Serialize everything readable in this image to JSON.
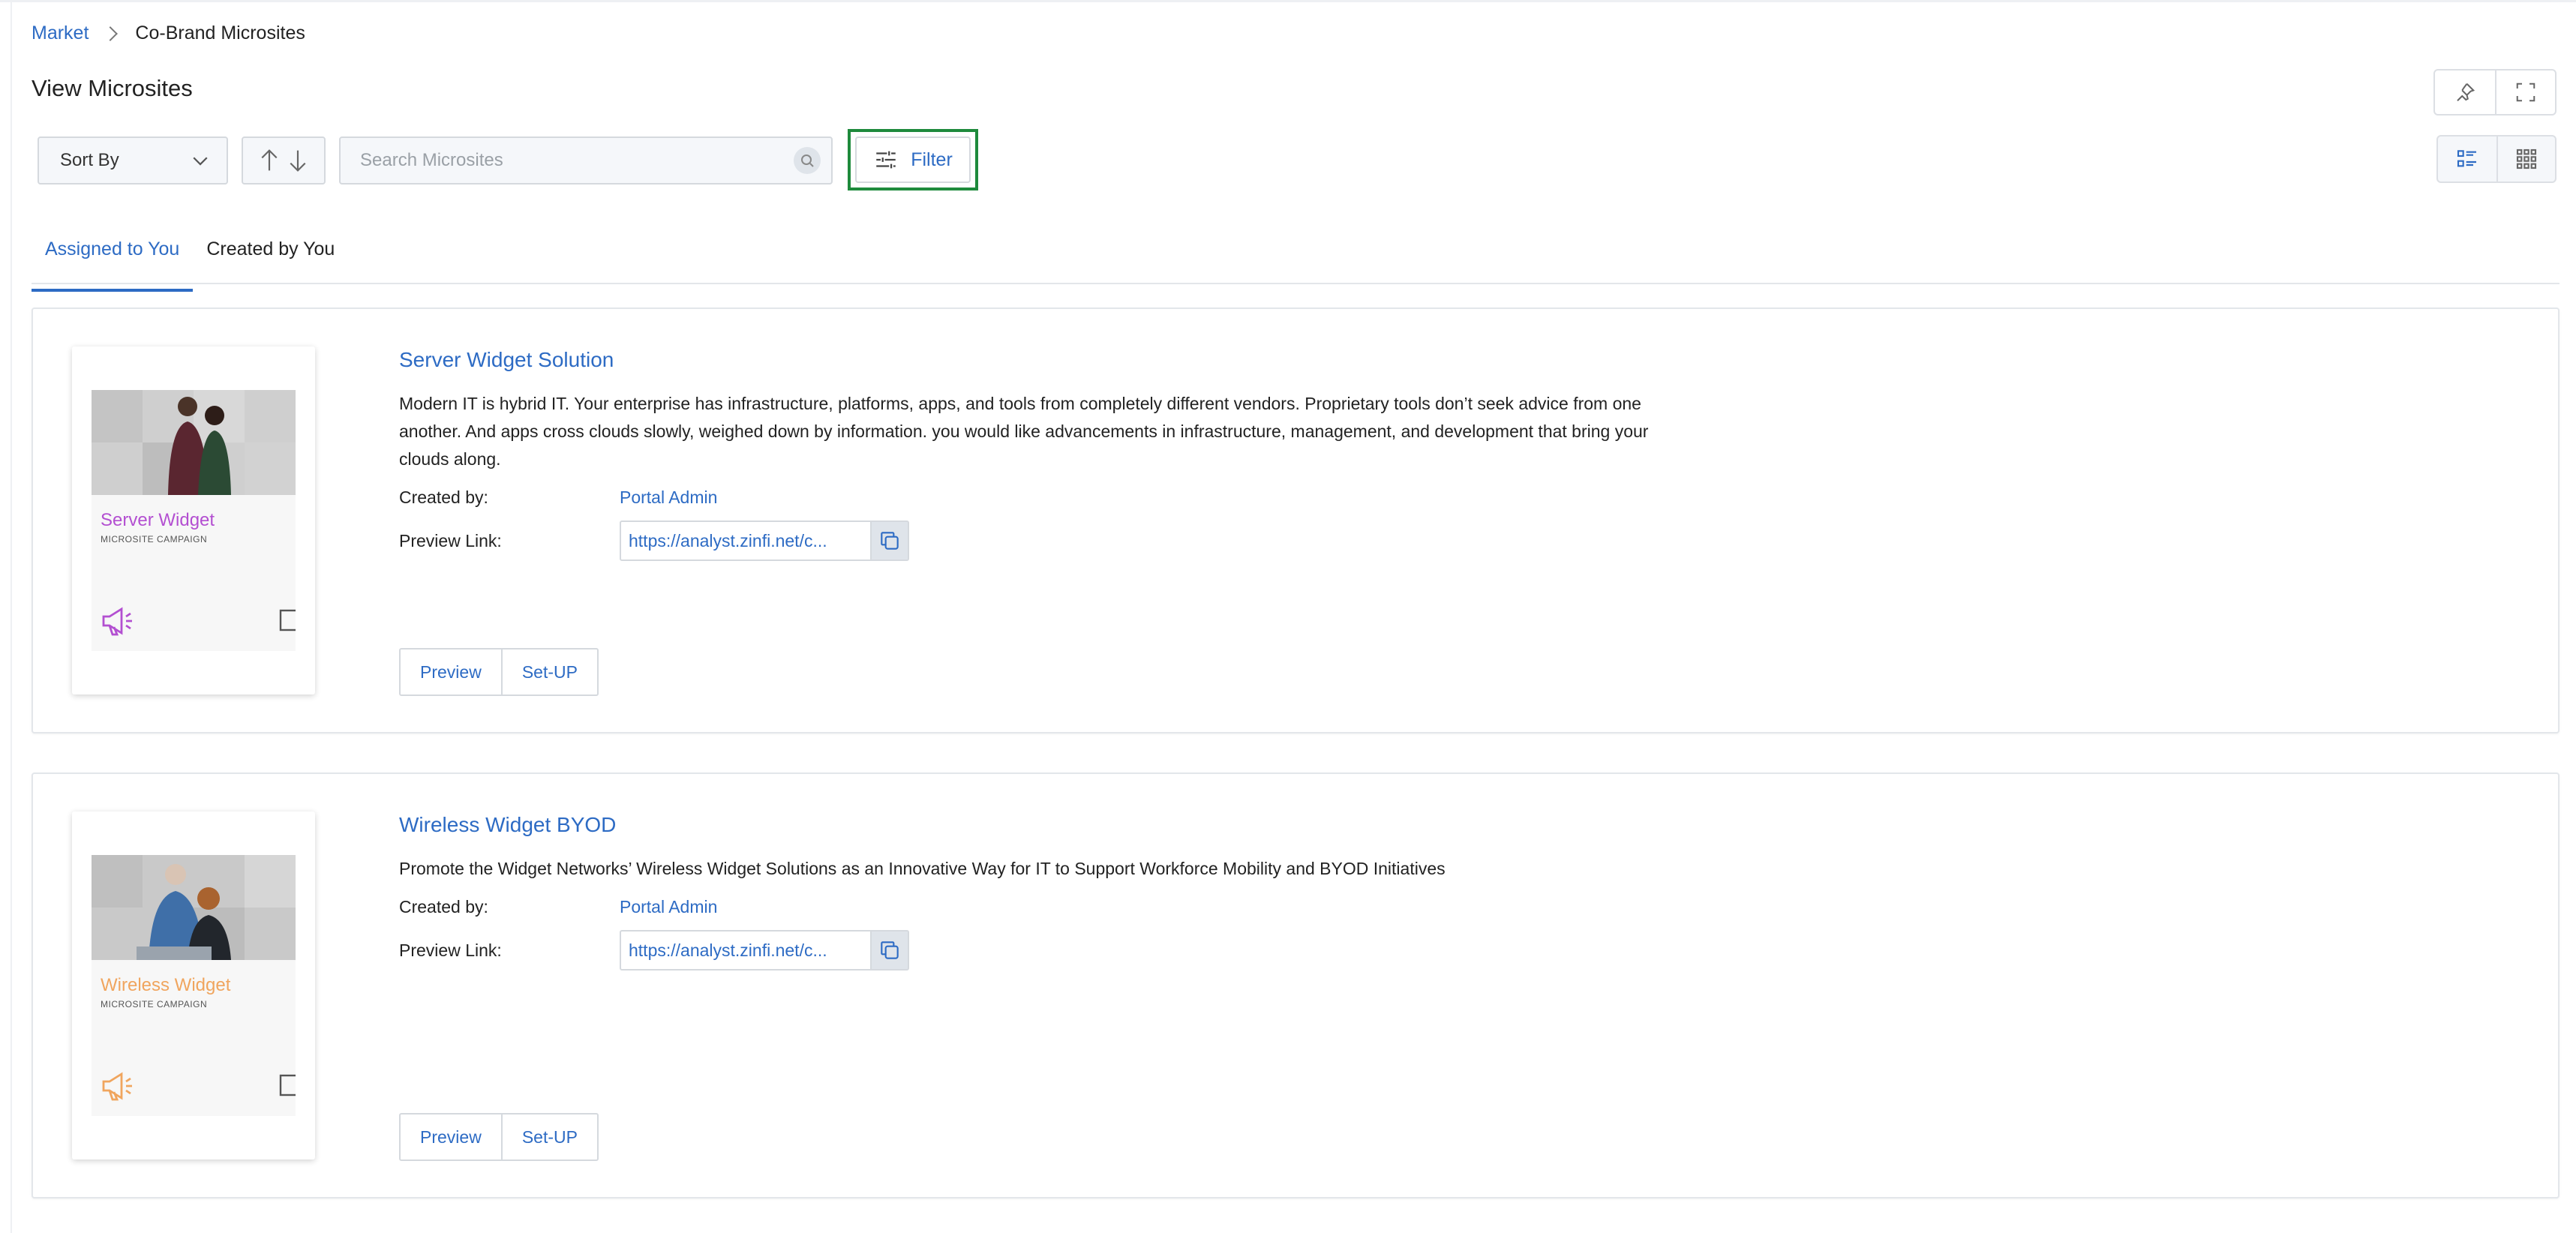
{
  "breadcrumb": {
    "items": [
      "Market",
      "Co-Brand Microsites"
    ]
  },
  "page": {
    "title": "View Microsites"
  },
  "toolbar": {
    "sort_label": "Sort By",
    "search_placeholder": "Search Microsites",
    "filter_label": "Filter"
  },
  "tabs": [
    {
      "label": "Assigned to You",
      "active": true
    },
    {
      "label": "Created by You",
      "active": false
    }
  ],
  "cards": [
    {
      "title": "Server Widget Solution",
      "description": "Modern IT is hybrid IT. Your enterprise has infrastructure, platforms, apps, and tools from completely different vendors. Proprietary tools don’t seek advice from one another. And apps cross clouds slowly, weighed down by information. you would like advancements in infrastructure, management, and development that bring your clouds along.",
      "created_by_label": "Created by:",
      "created_by": "Portal Admin",
      "preview_link_label": "Preview Link:",
      "preview_link": "https://analyst.zinfi.net/c...",
      "thumb_title": "Server Widget",
      "thumb_subtitle": "MICROSITE CAMPAIGN",
      "thumb_color": "#b34fd1",
      "preview_button": "Preview",
      "setup_button": "Set-UP"
    },
    {
      "title": "Wireless Widget BYOD",
      "description": "Promote the Widget Networks’ Wireless Widget Solutions as an Innovative Way for IT to Support Workforce Mobility and BYOD Initiatives",
      "created_by_label": "Created by:",
      "created_by": "Portal Admin",
      "preview_link_label": "Preview Link:",
      "preview_link": "https://analyst.zinfi.net/c...",
      "thumb_title": "Wireless Widget",
      "thumb_subtitle": "MICROSITE CAMPAIGN",
      "thumb_color": "#f0a55e",
      "preview_button": "Preview",
      "setup_button": "Set-UP"
    }
  ],
  "colors": {
    "accent": "#2d6bc4",
    "filter_highlight": "#1e8a3c"
  },
  "icons": [
    "chevron-right-icon",
    "pin-icon",
    "fullscreen-icon",
    "chevron-down-icon",
    "sort-up-icon",
    "sort-down-icon",
    "search-icon",
    "filter-icon",
    "list-view-icon",
    "grid-view-icon",
    "copy-icon",
    "megaphone-icon",
    "monitor-icon"
  ]
}
